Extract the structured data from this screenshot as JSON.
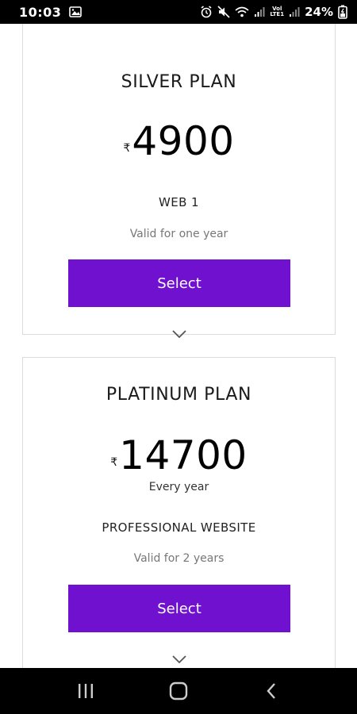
{
  "status_bar": {
    "time": "10:03",
    "battery": "24%",
    "lte_top": "Vol",
    "lte_bottom": "LTE1"
  },
  "plans": [
    {
      "name": "SILVER PLAN",
      "currency": "₹",
      "amount": "4900",
      "feature": "WEB 1",
      "validity": "Valid for one year",
      "button_label": "Select"
    },
    {
      "name": "PLATINUM PLAN",
      "currency": "₹",
      "amount": "14700",
      "period": "Every year",
      "feature": "PROFESSIONAL WEBSITE",
      "validity": "Valid for 2 years",
      "button_label": "Select"
    }
  ],
  "colors": {
    "accent": "#7011d0",
    "status_bar_bg": "#000000",
    "nav_bar_bg": "#000000"
  },
  "icons": {
    "status_left": [
      "image-icon"
    ],
    "status_right": [
      "alarm-icon",
      "mute-icon",
      "wifi-icon",
      "signal-icon",
      "lte-icon",
      "signal-icon",
      "battery-icon"
    ],
    "nav": [
      "recent-apps-icon",
      "home-icon",
      "back-icon"
    ],
    "expand": "chevron-down-icon"
  }
}
